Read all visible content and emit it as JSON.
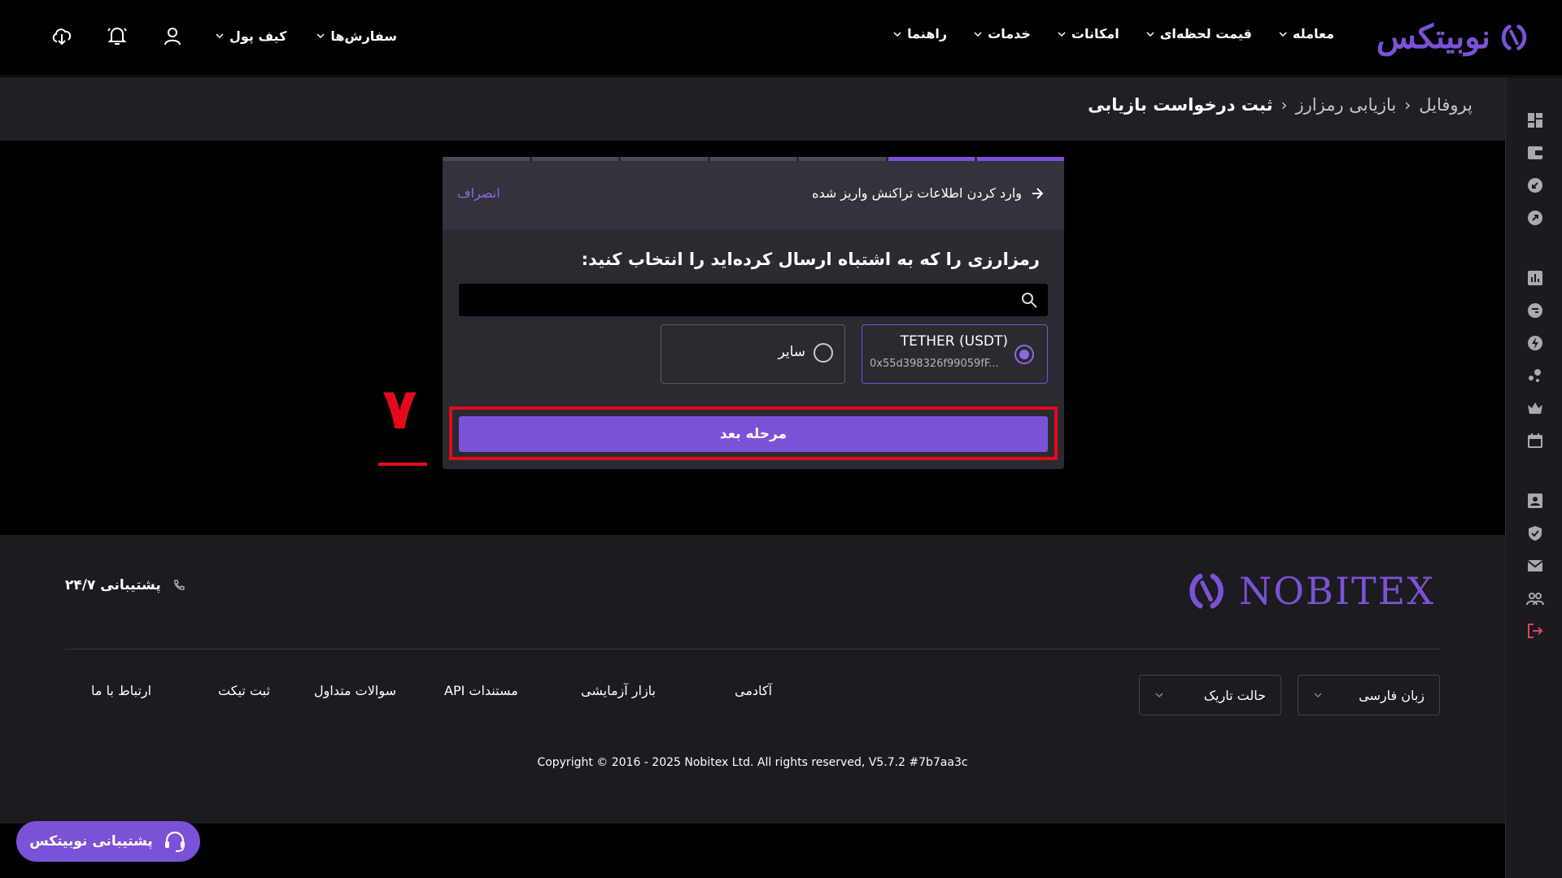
{
  "header": {
    "logo_text": "نوبیتکس",
    "nav": [
      "معامله",
      "قیمت لحظه‌ای",
      "امکانات",
      "خدمات",
      "راهنما"
    ],
    "user_nav": [
      "سفارش‌ها",
      "کیف پول"
    ]
  },
  "breadcrumb": {
    "items": [
      "پروفایل",
      "بازیابی رمزارز",
      "ثبت درخواست بازیابی"
    ]
  },
  "card": {
    "head_title": "وارد کردن اطلاعات تراکنش واریز شده",
    "cancel_label": "انصراف",
    "question": "رمزارزی را که به اشتباه ارسال کرده‌اید را انتخاب کنید:",
    "search_placeholder": "",
    "steps_total": 7,
    "steps_done": 2,
    "options": [
      {
        "name": "TETHER (USDT)",
        "address": "0x55d398326f99059fF...",
        "selected": true
      },
      {
        "name": "سایر",
        "address": "",
        "selected": false
      }
    ],
    "next_label": "مرحله بعد"
  },
  "annotation": {
    "number": "۷",
    "color": "#e30a1a"
  },
  "footer": {
    "logo_text": "NOBITEX",
    "support_24": "پشتیبانی ۲۴/۷",
    "links": [
      "آکادمی",
      "بازار آزمایشی",
      "مستندات API",
      "سوالات متداول",
      "ثبت تیکت",
      "ارتباط با ما"
    ],
    "language_label": "زبان فارسی",
    "theme_label": "حالت تاریک",
    "copyright": "Copyright © 2016 - 2025 Nobitex Ltd. All rights reserved, V5.7.2 #7b7aa3c"
  },
  "support_button": {
    "label": "پشتیبانی نوبیتکس"
  },
  "colors": {
    "accent": "#7b52d6",
    "highlight": "#e30a1a",
    "background": "#000000",
    "panel": "#2a2a31"
  }
}
